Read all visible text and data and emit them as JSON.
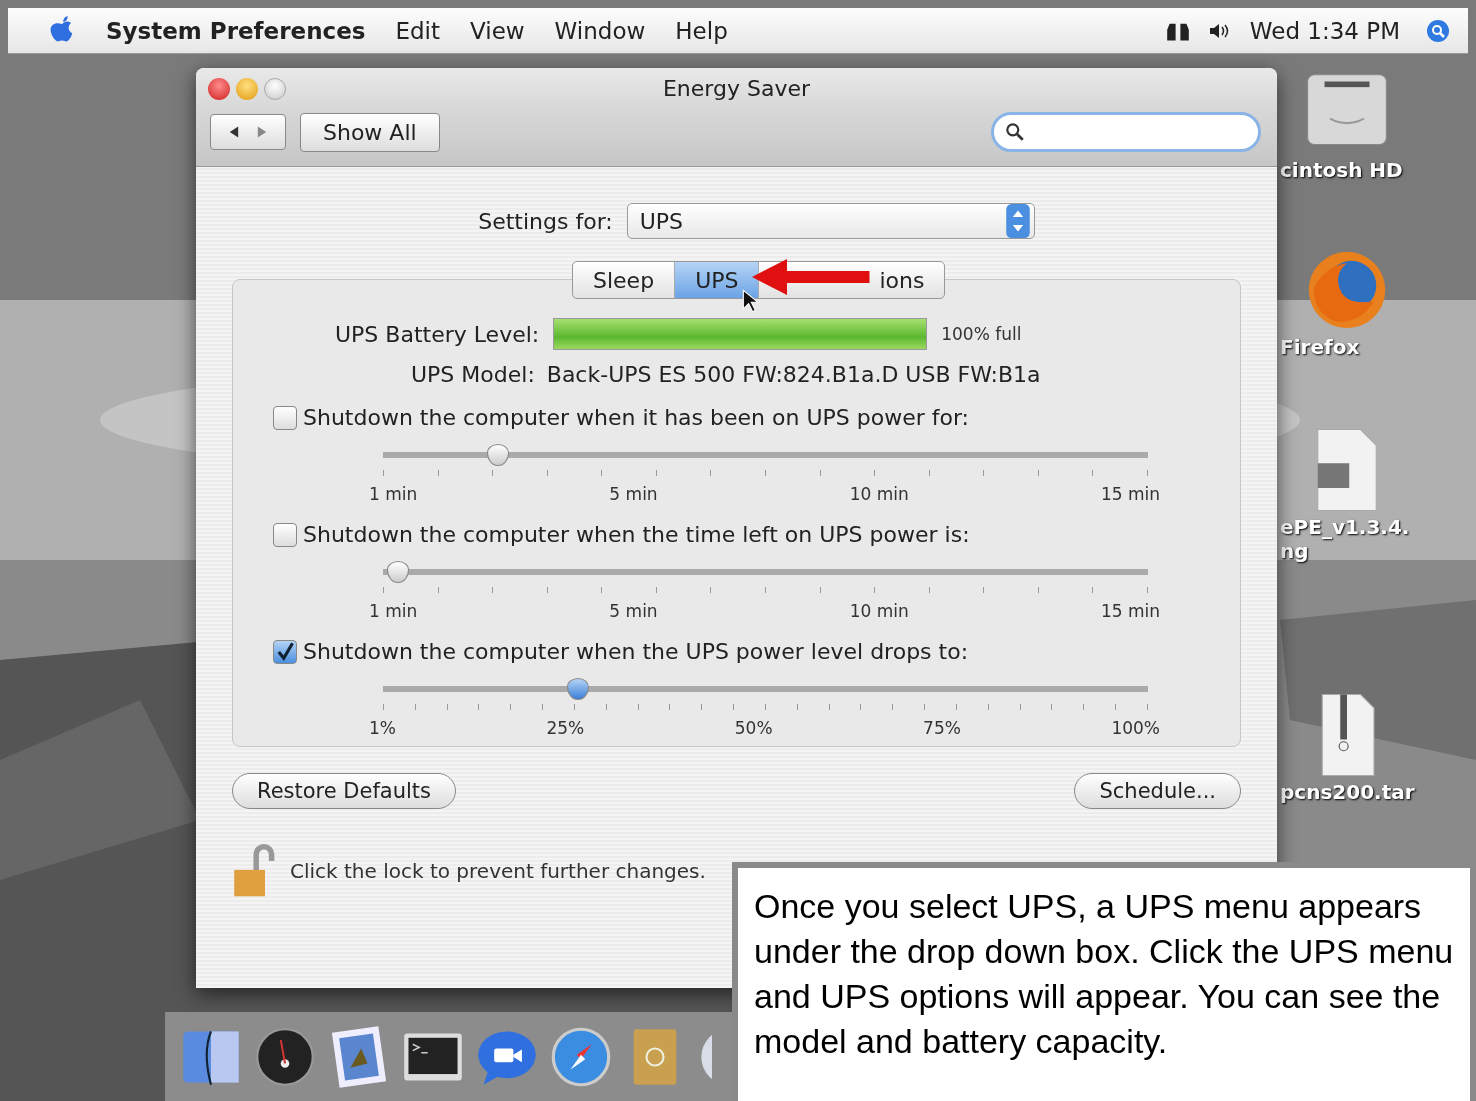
{
  "menu_bar": {
    "app_name": "System Preferences",
    "items": [
      "Edit",
      "View",
      "Window",
      "Help"
    ],
    "clock": "Wed 1:34 PM"
  },
  "window": {
    "title": "Energy Saver",
    "show_all": "Show All"
  },
  "settings_for": {
    "label": "Settings for:",
    "value": "UPS"
  },
  "tabs": [
    {
      "label": "Sleep",
      "selected": false
    },
    {
      "label": "UPS",
      "selected": true
    },
    {
      "label": "ions",
      "selected": false
    }
  ],
  "battery": {
    "label": "UPS Battery Level:",
    "level": 1.0,
    "reading": "100% full"
  },
  "model": {
    "label": "UPS Model:",
    "value": "Back-UPS ES 500 FW:824.B1a.D USB FW:B1a"
  },
  "options": [
    {
      "label": "Shutdown the computer when it has been on UPS power for:",
      "checked": false,
      "level": 0.15,
      "kind": "minutes",
      "tick_labels": [
        "1 min",
        "5 min",
        "10 min",
        "15 min"
      ]
    },
    {
      "label": "Shutdown the computer when the time left on UPS power is:",
      "checked": false,
      "level": 0.02,
      "kind": "minutes",
      "tick_labels": [
        "1 min",
        "5 min",
        "10 min",
        "15 min"
      ]
    },
    {
      "label": "Shutdown the computer when the UPS power level drops to:",
      "checked": true,
      "level": 0.255,
      "kind": "percent",
      "tick_labels": [
        "1%",
        "25%",
        "50%",
        "75%",
        "100%"
      ]
    }
  ],
  "buttons": {
    "restore": "Restore Defaults",
    "schedule": "Schedule..."
  },
  "lock": {
    "locked": false,
    "text": "Click the lock to prevent further changes."
  },
  "desktop_icons": [
    {
      "kind": "disk",
      "labels": [
        "cintosh HD"
      ]
    },
    {
      "kind": "browser",
      "labels": [
        "Firefox"
      ]
    },
    {
      "kind": "document",
      "labels": [
        "ePE_v1.3.4.",
        "ng"
      ]
    },
    {
      "kind": "archive",
      "labels": [
        "pcns200.tar"
      ]
    }
  ],
  "dock": [
    {
      "kind": "finder"
    },
    {
      "kind": "dashboard"
    },
    {
      "kind": "mail"
    },
    {
      "kind": "terminal"
    },
    {
      "kind": "chat"
    },
    {
      "kind": "safari"
    },
    {
      "kind": "contacts"
    },
    {
      "kind": "music"
    }
  ],
  "callout": "Once you select UPS, a UPS menu appears under the drop down box. Click the UPS menu and UPS options will appear. You can see the model and battery capacity."
}
